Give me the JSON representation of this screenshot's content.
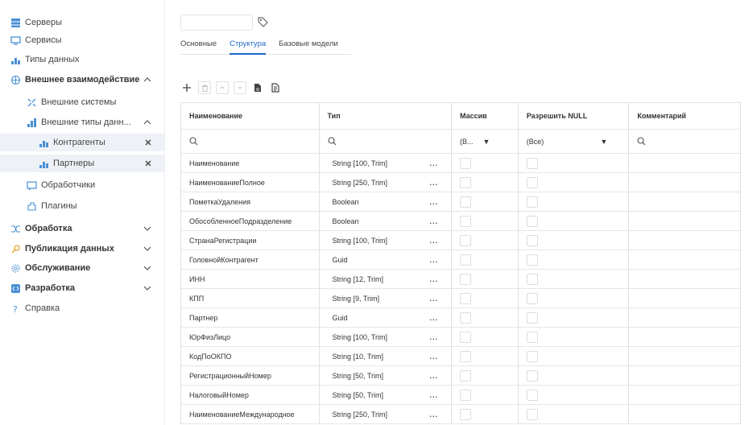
{
  "sidebar": {
    "items": [
      {
        "label": "Серверы",
        "icon": "server-icon",
        "bold": false,
        "chevron": "",
        "close": false
      },
      {
        "label": "Сервисы",
        "icon": "monitor-icon",
        "bold": false,
        "chevron": "",
        "close": false
      },
      {
        "label": "Типы данных",
        "icon": "data-types-icon",
        "bold": false,
        "chevron": "",
        "close": false
      },
      {
        "label": "Внешнее взаимодействие",
        "icon": "external-interaction-icon",
        "bold": true,
        "chevron": "^",
        "close": false
      },
      {
        "label": "Внешние системы",
        "icon": "external-systems-icon",
        "bold": false,
        "chevron": "",
        "close": false
      },
      {
        "label": "Внешние типы данн...",
        "icon": "external-types-icon",
        "bold": false,
        "chevron": "^",
        "close": false
      },
      {
        "label": "Контрагенты",
        "icon": "contractors-icon",
        "bold": false,
        "chevron": "",
        "close": true
      },
      {
        "label": "Партнеры",
        "icon": "partners-icon",
        "bold": false,
        "chevron": "",
        "close": true
      },
      {
        "label": "Обработчики",
        "icon": "handlers-icon",
        "bold": false,
        "chevron": "",
        "close": false
      },
      {
        "label": "Плагины",
        "icon": "plugins-icon",
        "bold": false,
        "chevron": "",
        "close": false
      },
      {
        "label": "Обработка",
        "icon": "processing-icon",
        "bold": true,
        "chevron": "v",
        "close": false
      },
      {
        "label": "Публикация данных",
        "icon": "publication-icon",
        "bold": true,
        "chevron": "v",
        "close": false
      },
      {
        "label": "Обслуживание",
        "icon": "maintenance-icon",
        "bold": true,
        "chevron": "v",
        "close": false
      },
      {
        "label": "Разработка",
        "icon": "development-icon",
        "bold": true,
        "chevron": "v",
        "close": false
      },
      {
        "label": "Справка",
        "icon": "help-icon",
        "bold": false,
        "chevron": "",
        "close": false
      }
    ]
  },
  "header": {
    "name_value": ""
  },
  "tabs": [
    {
      "label": "Основные",
      "active": false
    },
    {
      "label": "Структура",
      "active": true
    },
    {
      "label": "Базовые модели",
      "active": false
    }
  ],
  "toolbar": {
    "buttons": [
      "add-icon",
      "delete-icon",
      "move-up-icon",
      "move-down-icon",
      "document-icon",
      "document-alt-icon"
    ]
  },
  "grid": {
    "columns": [
      "Наименование",
      "Тип",
      "Массив",
      "Разрешить NULL",
      "Комментарий"
    ],
    "filters": {
      "array_value": "(В...",
      "null_value": "(Все)"
    },
    "more_label": "...",
    "rows": [
      {
        "name": "Наименование",
        "type": "String [100, Trim]"
      },
      {
        "name": "НаименованиеПолное",
        "type": "String [250, Trim]"
      },
      {
        "name": "ПометкаУдаления",
        "type": "Boolean"
      },
      {
        "name": "ОбособленноеПодразделение",
        "type": "Boolean"
      },
      {
        "name": "СтранаРегистрации",
        "type": "String [100, Trim]"
      },
      {
        "name": "ГоловнойКонтрагент",
        "type": "Guid"
      },
      {
        "name": "ИНН",
        "type": "String [12, Trim]"
      },
      {
        "name": "КПП",
        "type": "String [9, Trim]"
      },
      {
        "name": "Партнер",
        "type": "Guid"
      },
      {
        "name": "ЮрФизЛицо",
        "type": "String [100, Trim]"
      },
      {
        "name": "КодПоОКПО",
        "type": "String [10, Trim]"
      },
      {
        "name": "РегистрационныйНомер",
        "type": "String [50, Trim]"
      },
      {
        "name": "НалоговыйНомер",
        "type": "String [50, Trim]"
      },
      {
        "name": "НаименованиеМеждународное",
        "type": "String [250, Trim]"
      }
    ]
  },
  "colors": {
    "accent": "#1a66c8",
    "icon": "#4a8fd4",
    "border": "#e0e0e0"
  }
}
